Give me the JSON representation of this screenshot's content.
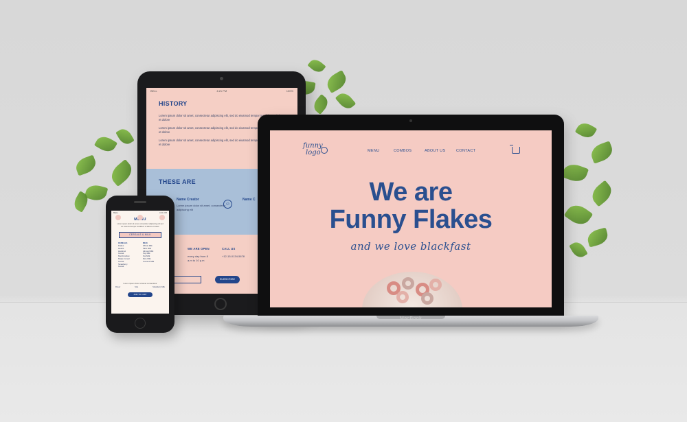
{
  "tablet": {
    "status": {
      "carrier": "BELL",
      "time": "4:21 PM",
      "battery": "100%"
    },
    "history": {
      "title": "HISTORY",
      "paragraphs": [
        "Lorem ipsum dolor sit amet, consectetur adipiscing elit, sed do eiusmod tempor incididunt ut labore et dolore",
        "Lorem ipsum dolor sit amet, consectetur adipiscing elit, sed do eiusmod tempor incididunt ut labore et dolore",
        "Lorem ipsum dolor sit amet, consectetur adipiscing elit, sed do eiusmod tempor incididunt ut labore et dolore"
      ]
    },
    "these_are": {
      "title": "THESE ARE",
      "item1_name": "Name Creator",
      "item1_desc": "Lorem ipsum dolor sit amet, consectetur adipiscing elit",
      "item2_name": "Name C"
    },
    "footer": {
      "open_title": "WE ARE OPEN",
      "open_text": "every day from 8 a.m to 10 p.m",
      "call_title": "CALL US",
      "call_text": "+12-15-0134-5678",
      "subscribe_label": "SUBSCRIBE"
    }
  },
  "laptop": {
    "brand": "MacBook",
    "logo_line1": "funny",
    "logo_line2": "logo",
    "nav": [
      "MENU",
      "COMBOS",
      "ABOUT US",
      "CONTACT"
    ],
    "hero_line1": "We are",
    "hero_line2": "Funny Flakes",
    "tagline": "and we love blackfast"
  },
  "phone": {
    "status": {
      "carrier": "BELL",
      "time": "4:21 PM"
    },
    "title": "MENU",
    "description": "Lorem ipsum dolor sit amet, consectetur adipiscing elit sed do eiusmod tempor incididunt ut labore et dolore",
    "button": "CEREALS & MILK",
    "cereals_header": "CEREALS",
    "cereals": [
      "Flakes",
      "Hearts",
      "Hazelnut",
      "Cereal",
      "Marshmallow",
      "Maple Cereal",
      "Cereal",
      "Strawberry",
      "Cereal"
    ],
    "milk_header": "MILK",
    "milk": [
      "Whole Milk",
      "Skim Milk",
      "Almond Milk",
      "Soy Milk",
      "Oat Milk",
      "Rice Milk",
      "Coconut Milk"
    ],
    "footer_note": "Lorem ipsum dolor sit amet consectetur",
    "footer_left": "Flavor",
    "footer_mid": "Size",
    "footer_right": "Strawberry Milk",
    "cta": "ADD TO CART"
  }
}
